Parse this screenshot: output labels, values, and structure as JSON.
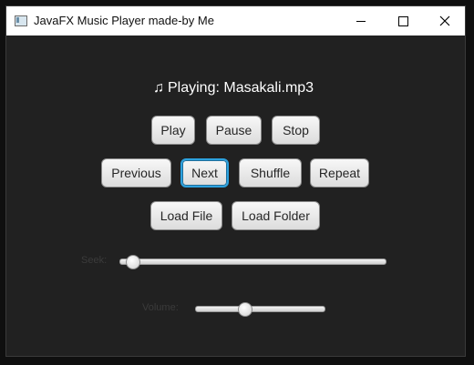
{
  "window": {
    "title": "JavaFX Music Player made-by Me"
  },
  "player": {
    "now_playing": "Playing: Masakali.mp3",
    "note_icon": "♫"
  },
  "buttons": {
    "play": "Play",
    "pause": "Pause",
    "stop": "Stop",
    "previous": "Previous",
    "next": "Next",
    "shuffle": "Shuffle",
    "repeat": "Repeat",
    "load_file": "Load File",
    "load_folder": "Load Folder"
  },
  "seek": {
    "label": "Seek:",
    "value_fraction": 0.03
  },
  "volume": {
    "label": "Volume:",
    "value_fraction": 0.38
  },
  "colors": {
    "background": "#212121",
    "focus_accent": "#2ca1de"
  }
}
